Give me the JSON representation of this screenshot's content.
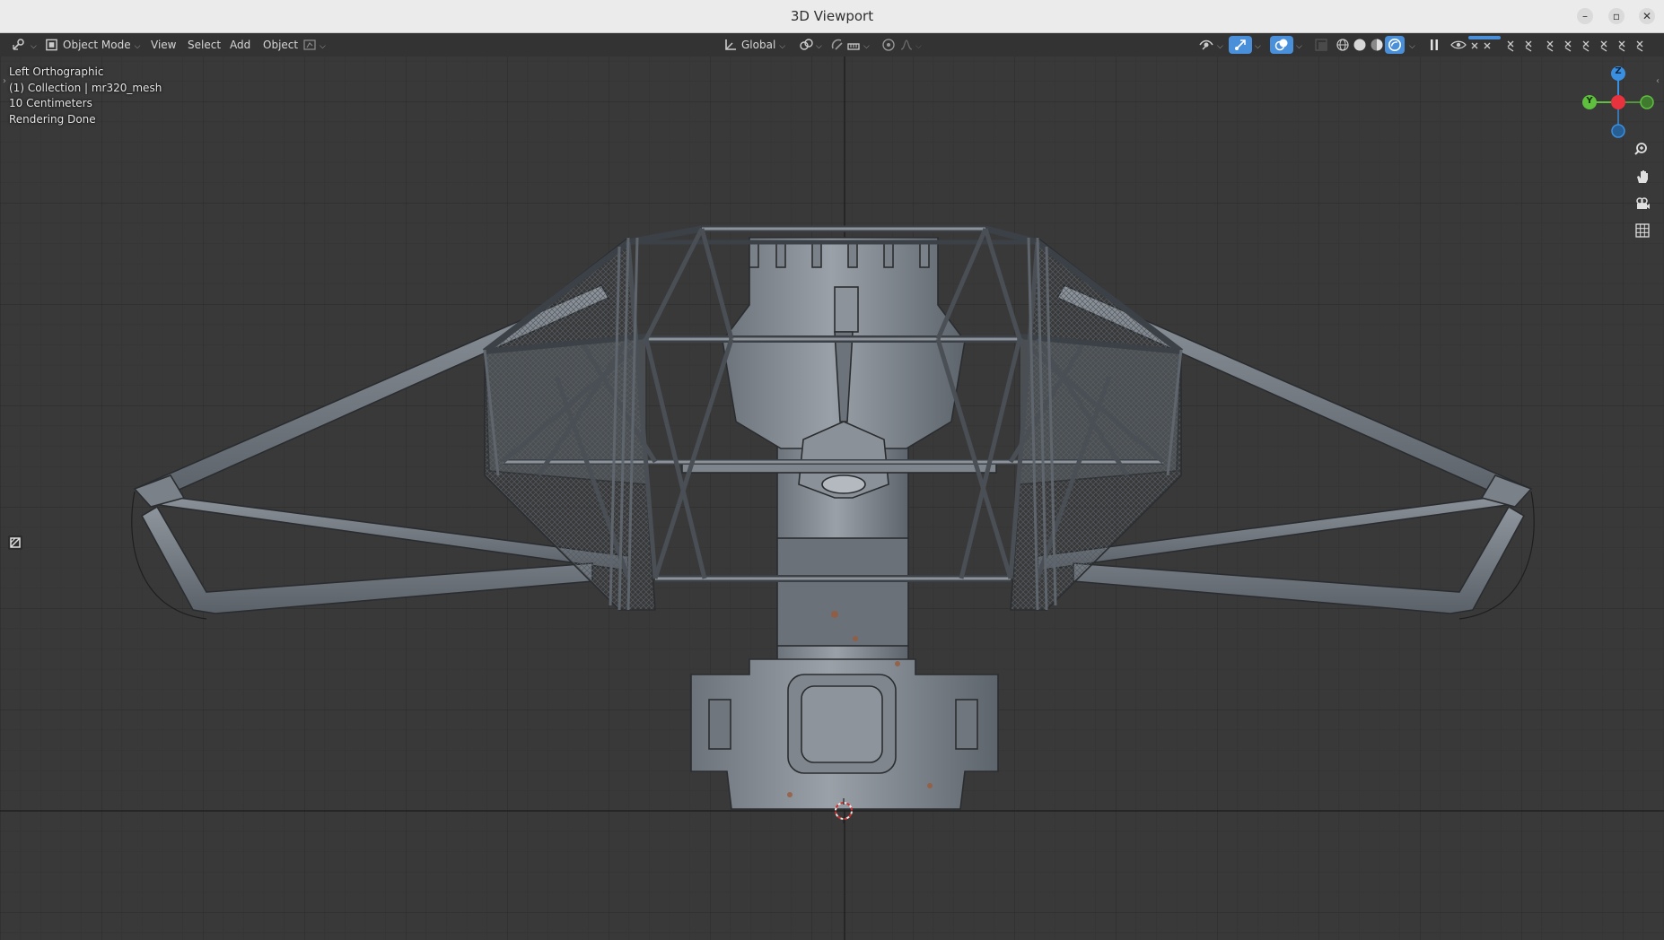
{
  "window": {
    "title": "3D Viewport"
  },
  "header": {
    "mode_label": "Object Mode",
    "menus": [
      "View",
      "Select",
      "Add",
      "Object"
    ],
    "orientation_label": "Global"
  },
  "overlay": {
    "view_name": "Left Orthographic",
    "collection": "(1) Collection | mr320_mesh",
    "grid_scale": "10 Centimeters",
    "status": "Rendering Done"
  },
  "gizmo": {
    "axes": [
      "Z",
      "Y"
    ]
  },
  "colors": {
    "x_axis": "#e8333f",
    "y_axis": "#5fbf3f",
    "z_axis": "#3b8fe0",
    "accent": "#4a8fd9",
    "viewport_bg": "#393939"
  },
  "icons": [
    "editor-type-icon",
    "object-mode-icon",
    "transform-orientation-icon",
    "pivot-icon",
    "snap-icon",
    "proportional-edit-icon",
    "visibility-icon",
    "gizmo-icon",
    "overlay-icon",
    "xray-icon",
    "wireframe-shading-icon",
    "solid-shading-icon",
    "material-shading-icon",
    "rendered-shading-icon",
    "pause-icon",
    "zoom-icon",
    "pan-hand-icon",
    "camera-icon",
    "ortho-grid-icon",
    "toolbox-icon",
    "3d-cursor-icon"
  ]
}
